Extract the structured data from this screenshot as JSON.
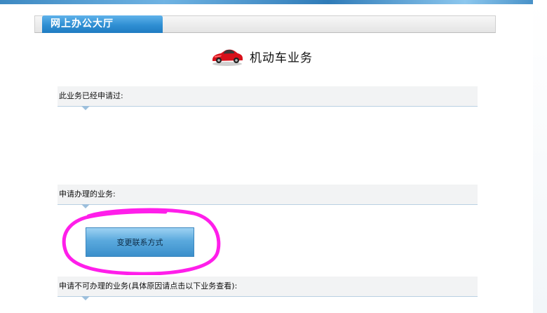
{
  "header": {
    "tab_label": "网上办公大厅"
  },
  "page": {
    "title": "机动车业务",
    "title_icon": "car-icon"
  },
  "sections": {
    "applied": {
      "label": "此业务已经申请过:"
    },
    "available": {
      "label": "申请办理的业务:",
      "buttons": [
        {
          "label": "变更联系方式"
        }
      ]
    },
    "unavailable": {
      "label": "申请不可办理的业务(具体原因请点击以下业务查看):"
    }
  },
  "colors": {
    "tab_blue": "#2f8fd3",
    "button_blue": "#5aa9dd",
    "highlight_magenta": "#ff1eea",
    "car_red": "#d8101a"
  }
}
